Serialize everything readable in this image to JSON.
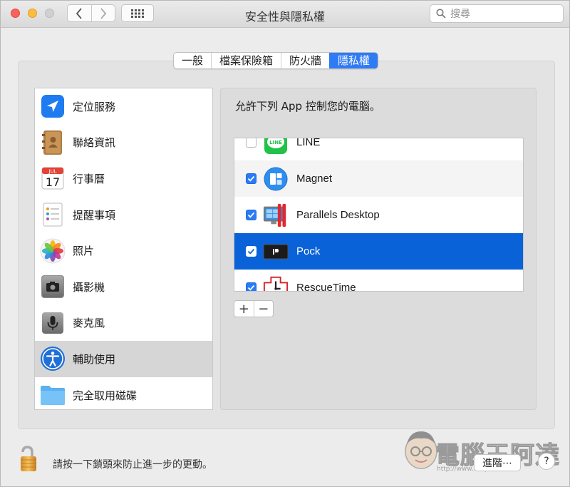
{
  "window": {
    "title": "安全性與隱私權"
  },
  "search": {
    "placeholder": "搜尋"
  },
  "tabs": [
    {
      "label": "一般",
      "active": false
    },
    {
      "label": "檔案保險箱",
      "active": false
    },
    {
      "label": "防火牆",
      "active": false
    },
    {
      "label": "隱私權",
      "active": true
    }
  ],
  "sidebar": {
    "items": [
      {
        "label": "定位服務",
        "icon": "location-arrow-icon"
      },
      {
        "label": "聯絡資訊",
        "icon": "contacts-icon"
      },
      {
        "label": "行事曆",
        "icon": "calendar-icon"
      },
      {
        "label": "提醒事項",
        "icon": "reminders-icon"
      },
      {
        "label": "照片",
        "icon": "photos-icon"
      },
      {
        "label": "攝影機",
        "icon": "camera-icon"
      },
      {
        "label": "麥克風",
        "icon": "microphone-icon"
      },
      {
        "label": "輔助使用",
        "icon": "accessibility-icon",
        "selected": true
      },
      {
        "label": "完全取用磁碟",
        "icon": "folder-icon"
      }
    ],
    "calendar_month": "JUL",
    "calendar_day": "17"
  },
  "main": {
    "heading": "允許下列 App 控制您的電腦。",
    "apps": [
      {
        "name": "LINE",
        "checked": false,
        "icon": "line-app-icon",
        "icon_text": "LINE"
      },
      {
        "name": "Magnet",
        "checked": true,
        "icon": "magnet-app-icon"
      },
      {
        "name": "Parallels Desktop",
        "checked": true,
        "icon": "parallels-app-icon"
      },
      {
        "name": "Pock",
        "checked": true,
        "icon": "pock-app-icon",
        "selected": true
      },
      {
        "name": "RescueTime",
        "checked": true,
        "icon": "rescuetime-app-icon"
      }
    ],
    "add_label": "+",
    "remove_label": "−"
  },
  "footer": {
    "lock_text": "請按一下鎖頭來防止進一步的更動。",
    "advanced_label": "進階⋯",
    "help_label": "?"
  },
  "watermark": {
    "text": "電腦王阿達",
    "url": "http://www.kocpc.com.tw"
  },
  "colors": {
    "accent": "#2f7af5",
    "selected_row": "#0a62d8"
  }
}
